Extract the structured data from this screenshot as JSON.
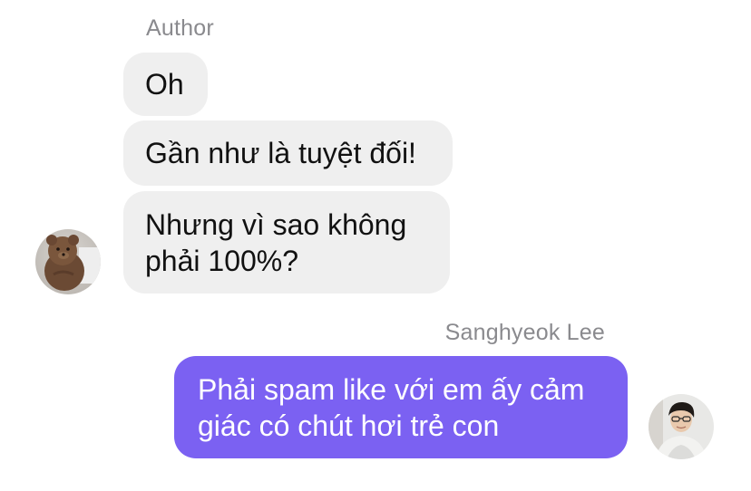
{
  "conversation": {
    "incoming": {
      "sender": "Author",
      "messages": [
        "Oh",
        "Gần như là tuyệt đối!",
        "Nhưng vì sao không\nphải 100%?"
      ]
    },
    "outgoing": {
      "sender": "Sanghyeok Lee",
      "messages": [
        "Phải spam like với em ấy cảm\ngiác có chút hơi trẻ con"
      ]
    }
  },
  "colors": {
    "incoming_bubble": "#efefef",
    "outgoing_bubble": "#7b61f2",
    "sender_name": "#8a8a8e"
  },
  "icons": {
    "incoming_avatar": "teddy-bear-avatar-icon",
    "outgoing_avatar": "person-photo-avatar-icon"
  }
}
